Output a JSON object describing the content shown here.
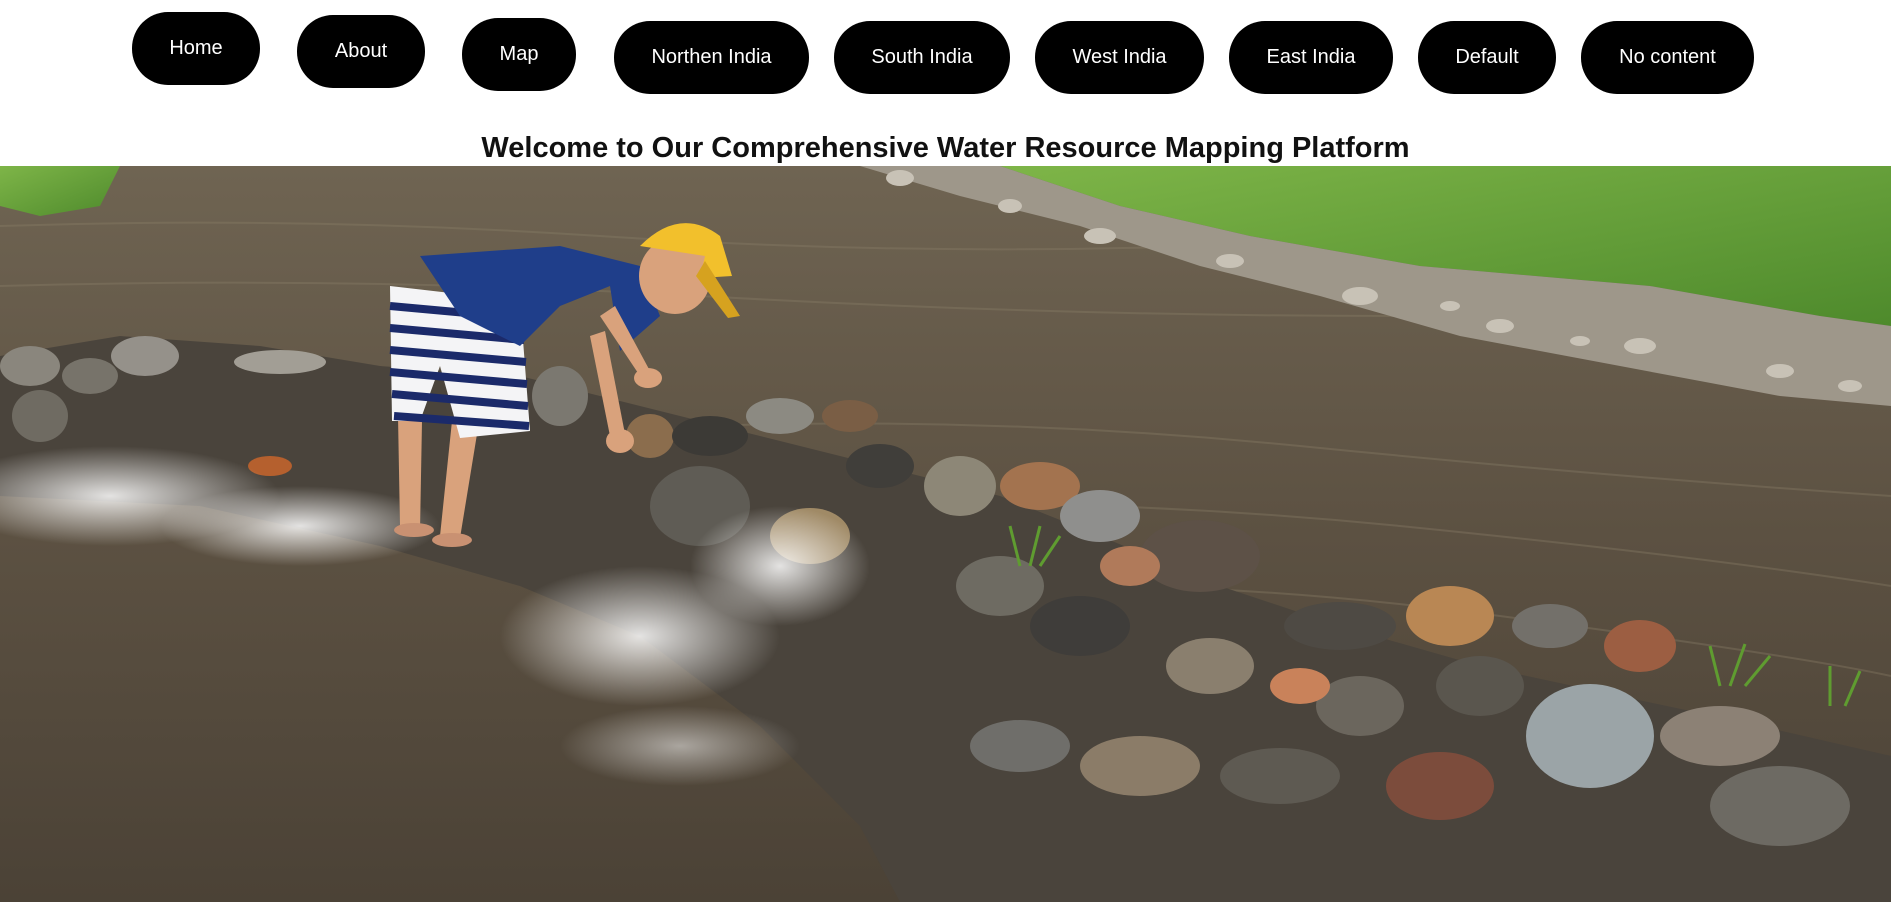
{
  "nav": {
    "items": [
      {
        "label": "Home"
      },
      {
        "label": "About"
      },
      {
        "label": "Map"
      },
      {
        "label": "Northen India"
      },
      {
        "label": "South India"
      },
      {
        "label": "West India"
      },
      {
        "label": "East India"
      },
      {
        "label": "Default"
      },
      {
        "label": "No content"
      }
    ]
  },
  "main": {
    "title": "Welcome to Our Comprehensive Water Resource Mapping Platform"
  },
  "hero": {
    "subject": "photo of a child in a yellow cap and blue shirt building a rock dam in a shallow stream",
    "colors": {
      "water": "#6b5f4f",
      "grass": "#6aa33a",
      "cap": "#f2c02c",
      "shirt": "#1f3e8a"
    }
  }
}
